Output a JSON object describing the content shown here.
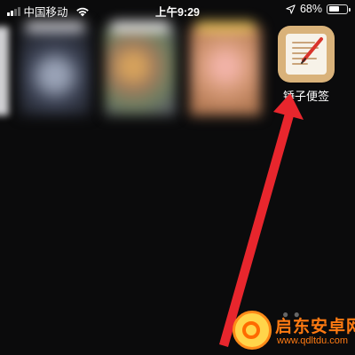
{
  "status_bar": {
    "carrier": "中国移动",
    "time": "上午9:29",
    "battery_percent": "68%",
    "battery_level": 0.68,
    "signal_bars": 2,
    "icons": [
      "signal-icon",
      "wifi-icon",
      "location-arrow-icon",
      "battery-icon"
    ]
  },
  "app_switcher": {
    "cards": [
      "blurred-app-card",
      "blurred-app-card",
      "blurred-app-card",
      "blurred-app-card"
    ]
  },
  "home_icon": {
    "label": "锤子便签",
    "icon": "notes-pen-icon",
    "colors": {
      "frame": "#d9b27a",
      "paper": "#f7f2e8",
      "pen": "#d9342b"
    }
  },
  "annotation": {
    "arrow_color": "#e8262d"
  },
  "watermark": {
    "title": "启东安卓网",
    "url": "www.qdltdu.com",
    "colors": {
      "text": "#ff7a12",
      "logo": "#ffd54a"
    }
  }
}
